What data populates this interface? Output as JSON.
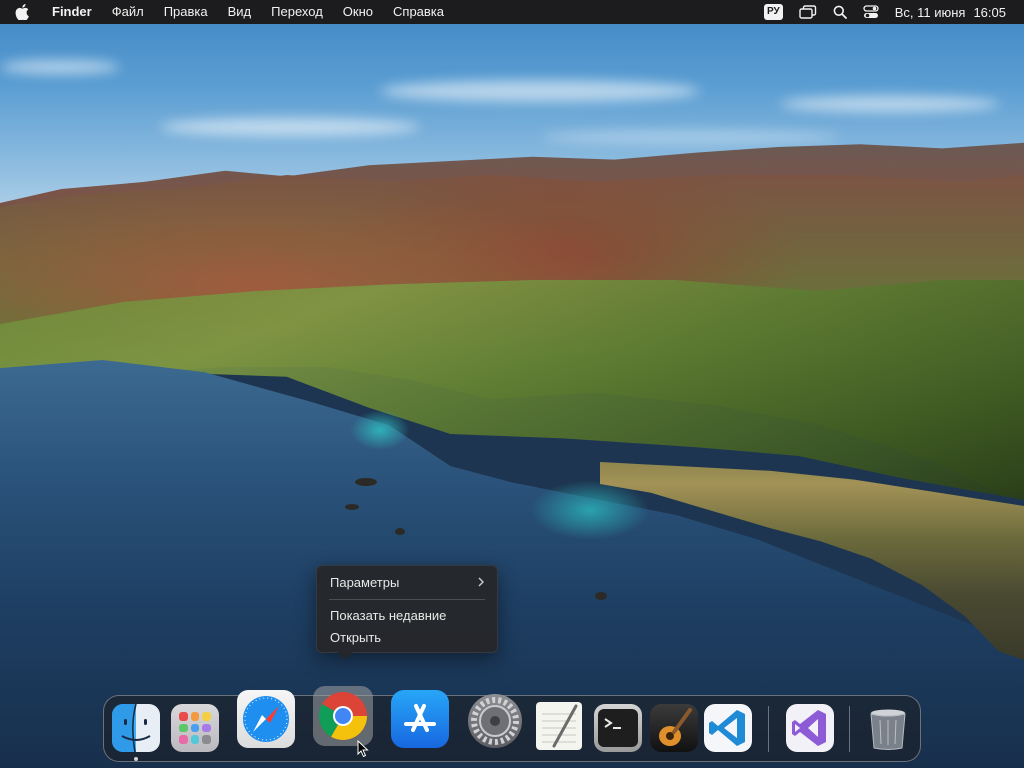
{
  "menubar": {
    "app_name": "Finder",
    "menus": [
      "Файл",
      "Правка",
      "Вид",
      "Переход",
      "Окно",
      "Справка"
    ],
    "input_language": "РУ",
    "date": "Вс, 11 июня",
    "time": "16:05"
  },
  "context_menu": {
    "items": [
      {
        "label": "Параметры",
        "has_submenu": true
      },
      {
        "label": "Показать недавние",
        "has_submenu": false
      },
      {
        "label": "Открыть",
        "has_submenu": false
      }
    ]
  },
  "dock": {
    "apps": [
      {
        "name": "finder",
        "running": true
      },
      {
        "name": "launchpad",
        "running": false
      },
      {
        "name": "safari",
        "running": false
      },
      {
        "name": "google-chrome",
        "running": false,
        "highlighted": true
      },
      {
        "name": "app-store",
        "running": false
      },
      {
        "name": "system-preferences",
        "running": false
      },
      {
        "name": "textedit",
        "running": false
      },
      {
        "name": "terminal",
        "running": false
      },
      {
        "name": "garageband",
        "running": false
      },
      {
        "name": "visual-studio-code",
        "running": false
      },
      {
        "name": "visual-studio",
        "running": false
      },
      {
        "name": "trash",
        "running": false
      }
    ]
  },
  "icons": {
    "apple": "apple-logo-icon",
    "window_switcher": "screen-mirroring-icon",
    "search": "spotlight-search-icon",
    "control_center": "control-center-icon",
    "chevron": "chevron-right-icon"
  },
  "colors": {
    "menubar_bg": "#1c1c1e",
    "menu_bg": "#262628",
    "menu_text": "#e8e8e8"
  }
}
